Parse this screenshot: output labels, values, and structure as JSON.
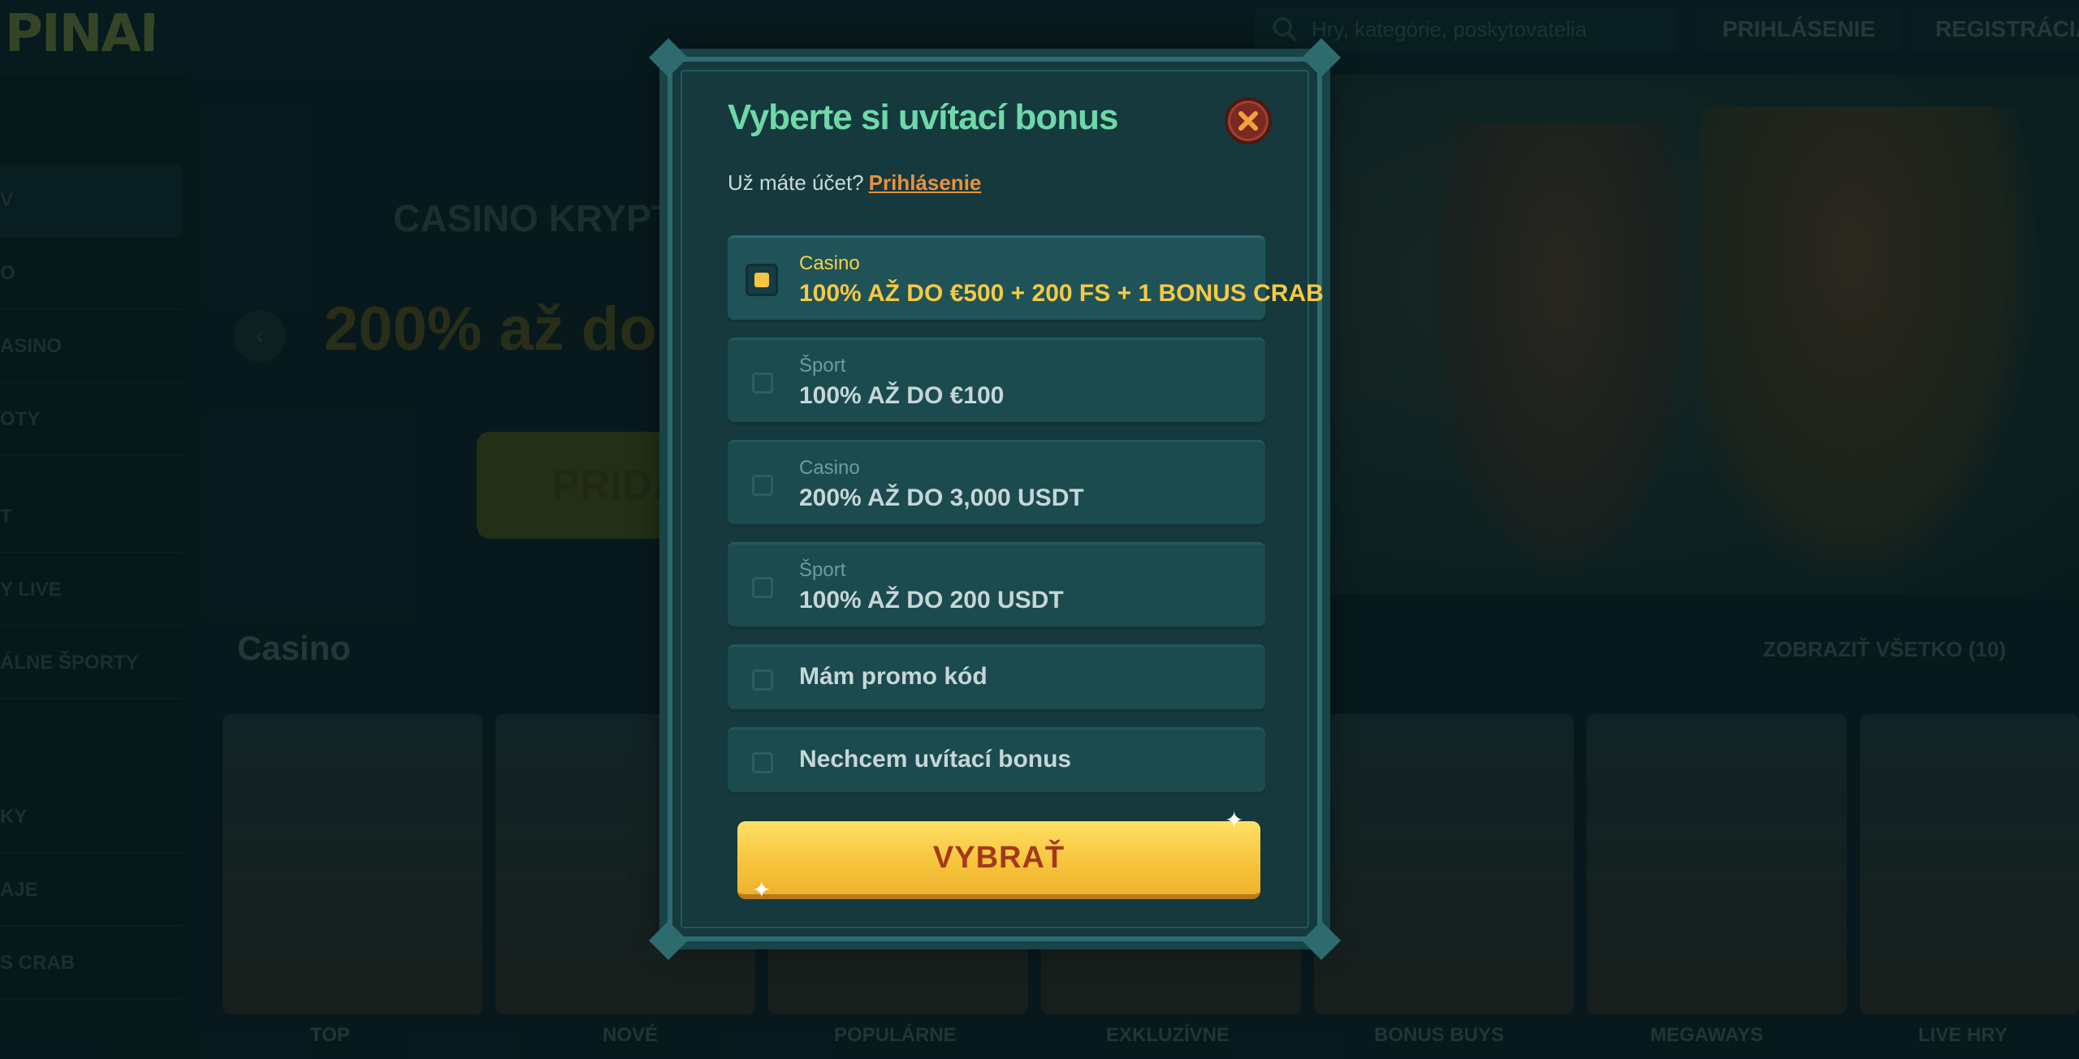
{
  "header": {
    "logo_text": "PINANGA",
    "search_placeholder": "Hry, kategórie, poskytovatelia",
    "login_label": "PRIHLÁSENIE",
    "register_label": "REGISTRÁCIA"
  },
  "sidebar": {
    "items": [
      {
        "label": "V"
      },
      {
        "label": "O"
      },
      {
        "label": "ASINO"
      },
      {
        "label": "OTY"
      },
      {
        "label": "T"
      },
      {
        "label": "Y LIVE"
      },
      {
        "label": "ÁLNE ŠPORTY"
      },
      {
        "label": "KY"
      },
      {
        "label": "AJE"
      },
      {
        "label": "S CRAB"
      }
    ]
  },
  "hero": {
    "title": "CASINO KRYPT",
    "headline": "200% až do",
    "cta_label": "PRIDAJT",
    "prev_arrow": "‹"
  },
  "section": {
    "title": "Casino",
    "show_all": "ZOBRAZIŤ VŠETKO (10)"
  },
  "categories": [
    "TOP",
    "NOVÉ",
    "POPULÁRNE",
    "EXKLUZÍVNE",
    "BONUS BUYS",
    "MEGAWAYS",
    "LIVE HRY"
  ],
  "modal": {
    "title": "Vyberte si uvítací bonus",
    "account_question": "Už máte účet?",
    "login_link": "Prihlásenie",
    "options": [
      {
        "category": "Casino",
        "amount": "100% AŽ DO €500 + 200 FS + 1 BONUS CRAB",
        "selected": true
      },
      {
        "category": "Šport",
        "amount": "100% AŽ DO €100",
        "selected": false
      },
      {
        "category": "Casino",
        "amount": "200% AŽ DO 3,000 USDT",
        "selected": false
      },
      {
        "category": "Šport",
        "amount": "100% AŽ DO 200 USDT",
        "selected": false
      }
    ],
    "promo_option": "Mám promo kód",
    "no_bonus_option": "Nechcem uvítací bonus",
    "select_button": "VYBRAŤ"
  },
  "colors": {
    "accent_green": "#6fd8a9",
    "accent_yellow": "#f6c945",
    "link_orange": "#e8913c",
    "button_text": "#a5381a"
  }
}
